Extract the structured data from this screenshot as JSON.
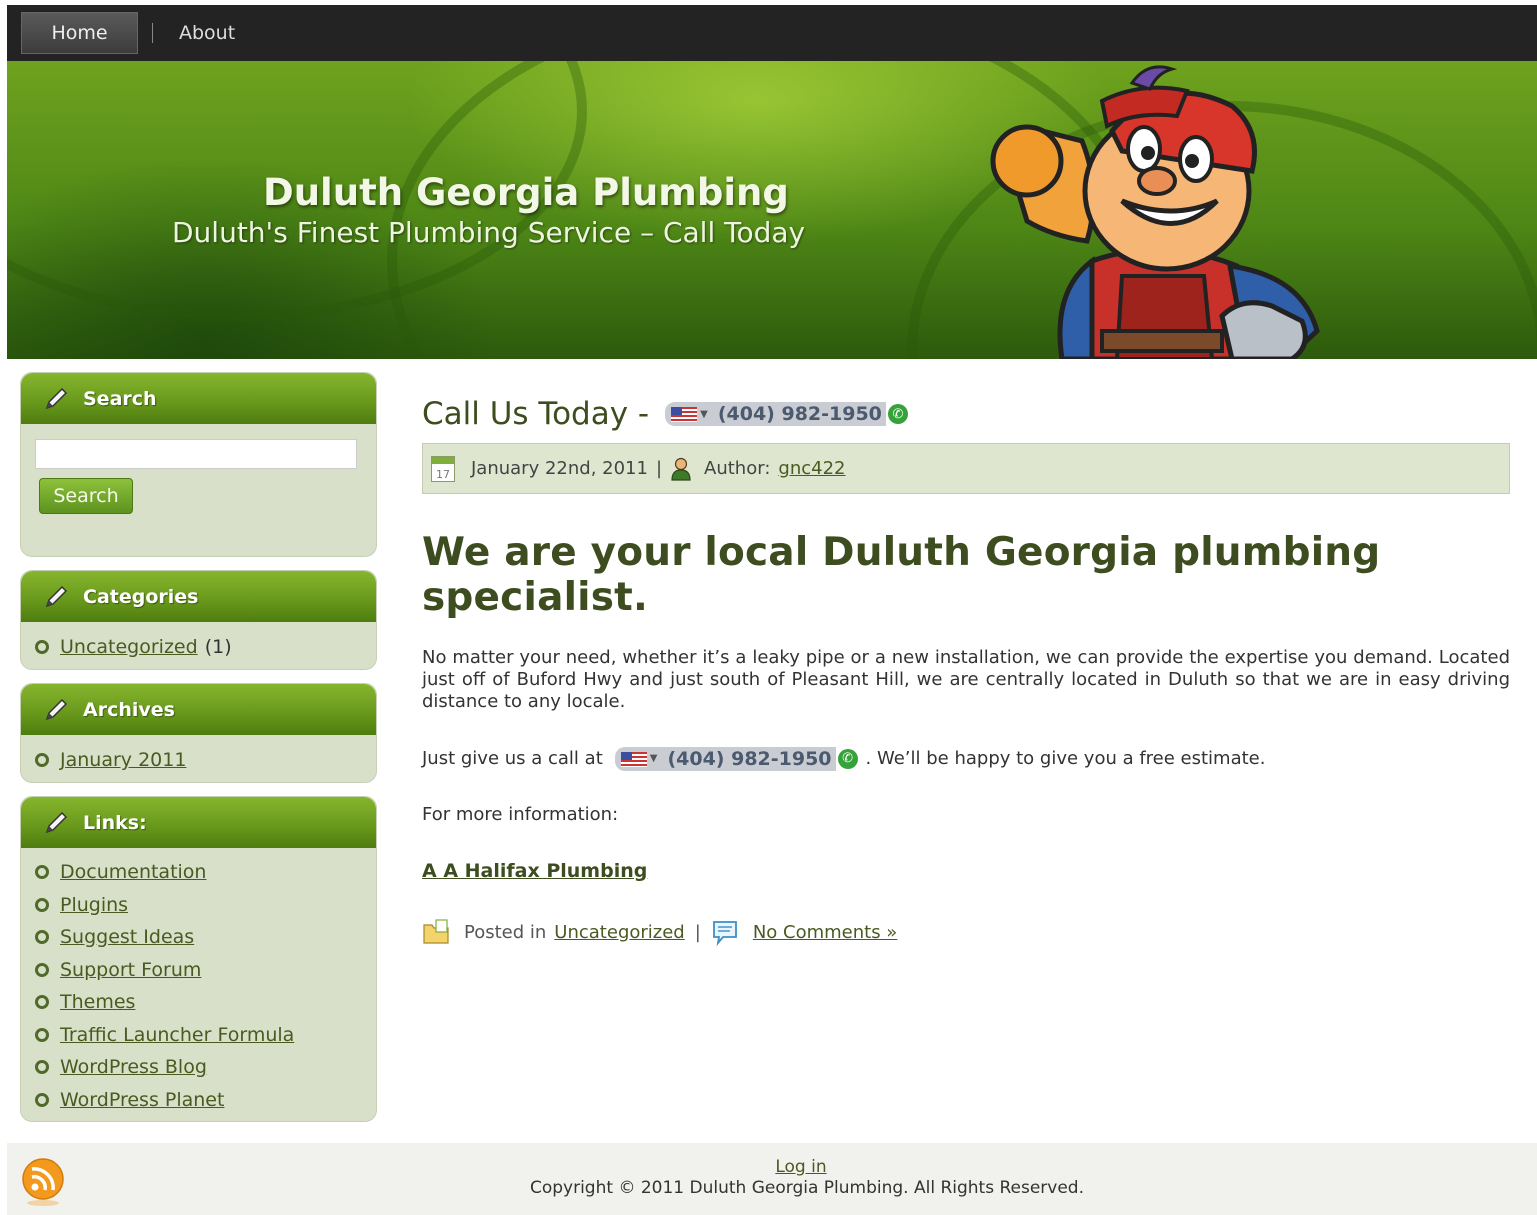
{
  "nav": {
    "home": "Home",
    "about": "About"
  },
  "header": {
    "title": "Duluth Georgia Plumbing",
    "tagline": "Duluth's Finest Plumbing Service – Call Today"
  },
  "sidebar": {
    "search": {
      "title": "Search",
      "placeholder": "",
      "button": "Search"
    },
    "categories": {
      "title": "Categories",
      "items": [
        {
          "label": "Uncategorized",
          "count": "(1)"
        }
      ]
    },
    "archives": {
      "title": "Archives",
      "items": [
        {
          "label": "January 2011"
        }
      ]
    },
    "links": {
      "title": "Links:",
      "items": [
        {
          "label": "Documentation"
        },
        {
          "label": "Plugins"
        },
        {
          "label": "Suggest Ideas"
        },
        {
          "label": "Support Forum"
        },
        {
          "label": "Themes"
        },
        {
          "label": "Traffic Launcher Formula"
        },
        {
          "label": "WordPress Blog"
        },
        {
          "label": "WordPress Planet"
        }
      ]
    }
  },
  "post": {
    "title": "Call Us Today -",
    "phone": "(404) 982-1950",
    "date": "January 22nd, 2011",
    "cal_day": "17",
    "meta_sep": "|",
    "author_label": "Author:",
    "author": "gnc422",
    "heading": "We are your local Duluth Georgia plumbing specialist.",
    "para1": "No matter your need, whether it’s a leaky pipe or a new installation, we can provide the expertise you demand. Located just off of Buford Hwy and just south of Pleasant Hill, we are centrally located in Duluth so that we are in easy driving distance to any locale.",
    "para2_before": "Just give us a call at",
    "para2_after": ". We’ll be happy to give you a free estimate.",
    "para3": "For more information:",
    "link": "A A Halifax Plumbing",
    "posted_in": "Posted in",
    "category": "Uncategorized",
    "footer_sep": "|",
    "comments": "No Comments »"
  },
  "footer": {
    "login": "Log in",
    "copyright": "Copyright © 2011 Duluth Georgia Plumbing. All Rights Reserved."
  },
  "colors": {
    "accent_green": "#6a9a1c",
    "text_dark_green": "#3d4d1f",
    "widget_bg": "#d8e0c9"
  }
}
